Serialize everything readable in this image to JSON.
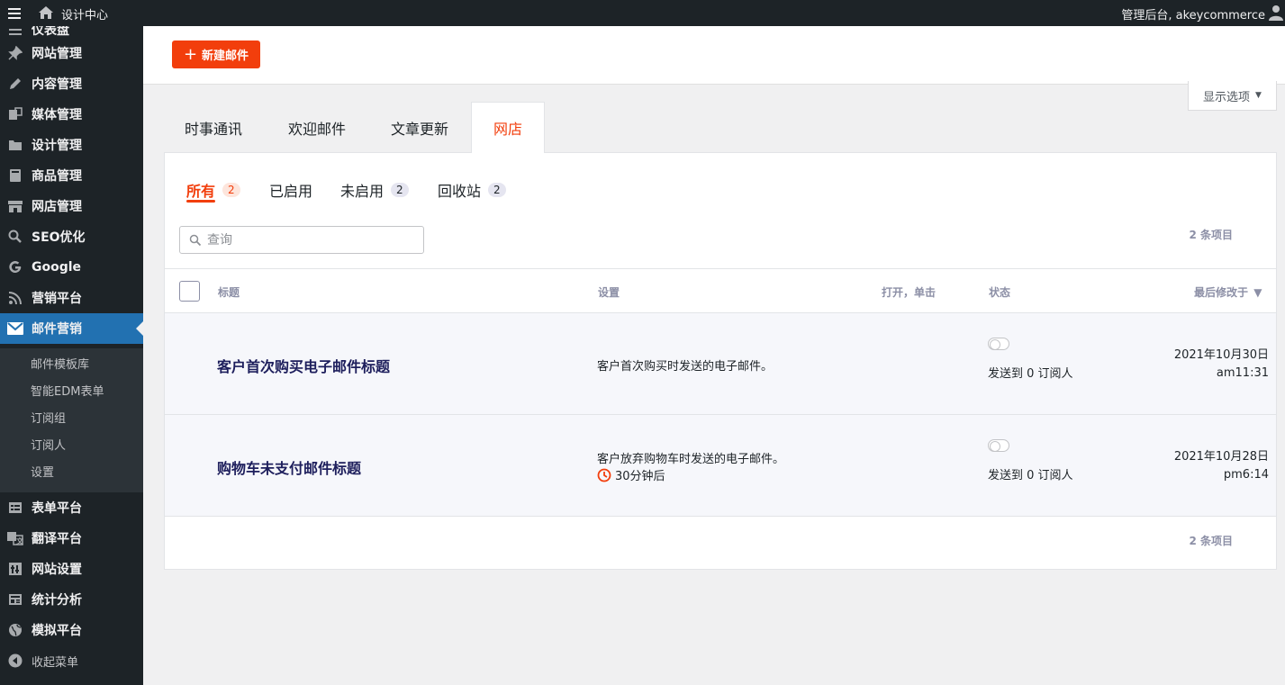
{
  "topbar": {
    "site_name": "设计中心",
    "account": "管理后台, akeycommerce"
  },
  "sidebar": {
    "items": [
      {
        "label": "仪表盘",
        "icon": "dashboard-icon"
      },
      {
        "label": "网站管理",
        "icon": "pin-icon"
      },
      {
        "label": "内容管理",
        "icon": "pencil-icon"
      },
      {
        "label": "媒体管理",
        "icon": "media-icon"
      },
      {
        "label": "设计管理",
        "icon": "folder-icon"
      },
      {
        "label": "商品管理",
        "icon": "book-icon"
      },
      {
        "label": "网店管理",
        "icon": "store-icon"
      },
      {
        "label": "SEO优化",
        "icon": "search-icon"
      },
      {
        "label": "Google",
        "icon": "google-icon"
      },
      {
        "label": "营销平台",
        "icon": "rss-icon"
      },
      {
        "label": "邮件营销",
        "icon": "mail-icon"
      },
      {
        "label": "表单平台",
        "icon": "form-icon"
      },
      {
        "label": "翻译平台",
        "icon": "translate-icon"
      },
      {
        "label": "网站设置",
        "icon": "settings-icon"
      },
      {
        "label": "统计分析",
        "icon": "stats-icon"
      },
      {
        "label": "模拟平台",
        "icon": "globe-icon"
      }
    ],
    "submenu": [
      "邮件模板库",
      "智能EDM表单",
      "订阅组",
      "订阅人",
      "设置"
    ],
    "collapse": "收起菜单"
  },
  "header": {
    "new_button": "新建邮件",
    "screen_options": "显示选项"
  },
  "tabs": [
    "时事通讯",
    "欢迎邮件",
    "文章更新",
    "网店"
  ],
  "filters": [
    {
      "label": "所有",
      "count": "2"
    },
    {
      "label": "已启用",
      "count": ""
    },
    {
      "label": "未启用",
      "count": "2"
    },
    {
      "label": "回收站",
      "count": "2"
    }
  ],
  "search": {
    "placeholder": "查询"
  },
  "items_count": "2 条项目",
  "table": {
    "columns": {
      "title": "标题",
      "settings": "设置",
      "opens": "打开，单击",
      "status": "状态",
      "modified": "最后修改于"
    },
    "rows": [
      {
        "title": "客户首次购买电子邮件标题",
        "description": "客户首次购买时发送的电子邮件。",
        "delay": "",
        "status": "发送到 0 订阅人",
        "date": "2021年10月30日",
        "time": "am11:31"
      },
      {
        "title": "购物车未支付邮件标题",
        "description": "客户放弃购物车时发送的电子邮件。",
        "delay": "30分钟后",
        "status": "发送到 0 订阅人",
        "date": "2021年10月28日",
        "time": "pm6:14"
      }
    ]
  },
  "colors": {
    "accent": "#f23e0c",
    "sidebar_bg": "#1d2327",
    "active_menu": "#2271b1"
  }
}
